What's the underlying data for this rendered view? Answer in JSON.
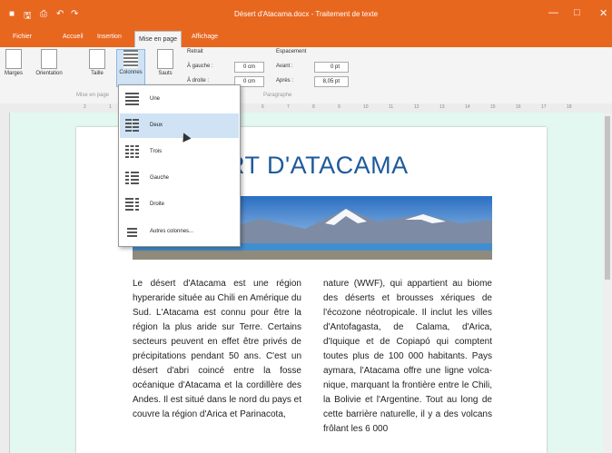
{
  "window": {
    "title": "Désert d'Atacama.docx - Traitement de texte"
  },
  "quick_access": {
    "new": "■",
    "save": "🖫",
    "print": "⎙",
    "undo": "↶",
    "redo": "↷"
  },
  "window_controls": {
    "minimize": "—",
    "maximize": "□",
    "close": "✕"
  },
  "tabs": [
    "Fichier",
    "Accueil",
    "Insertion",
    "Mise en page",
    "Affichage"
  ],
  "active_tab": "Mise en page",
  "ribbon": {
    "buttons": [
      "Marges",
      "Orientation",
      "Taille",
      "Colonnes",
      "Sauts"
    ],
    "retrait": {
      "label": "Retrait",
      "left_label": "À gauche :",
      "left_value": "0 cm",
      "right_label": "À droite :",
      "right_value": "0 cm"
    },
    "espacement": {
      "label": "Espacement",
      "before_label": "Avant :",
      "before_value": "0 pt",
      "after_label": "Après :",
      "after_value": "8,05 pt"
    },
    "group_labels": [
      "Mise en page",
      "Paragraphe"
    ]
  },
  "ruler_ticks": [
    "2",
    "1",
    "1",
    "2",
    "3",
    "4",
    "5",
    "6",
    "7",
    "8",
    "9",
    "10",
    "11",
    "12",
    "13",
    "14",
    "15",
    "16",
    "17",
    "18"
  ],
  "columns_menu": {
    "items": [
      "Une",
      "Deux",
      "Trois",
      "Gauche",
      "Droite",
      "Autres colonnes..."
    ],
    "highlighted": "Deux"
  },
  "document": {
    "heading": "RT D'ATACAMA",
    "col1": "Le désert d'Atacama est une région hyperaride située au Chili en Amérique du Sud. L'Atacama est connu pour être la région la plus aride sur Terre. Certains secteurs peuvent en effet être privés de précipitations pendant 50 ans. C'est un désert d'abri coincé entre la fosse océanique d'Atacama et la cordillère des Andes. Il est situé dans le nord du pays et couvre la région d'Arica et Parinacota,",
    "col2": "nature (WWF), qui appartient au biome des déserts et brousses xériques de l'écozone néotropicale. Il inclut les villes d'Antofagasta, de Calama, d'Arica, d'Iquique et de Copiapó qui comptent toutes plus de 100 000 habitants. Pays aymara, l'Atacama offre une ligne volca-nique, marquant la frontière entre le Chili, la Bolivie et l'Argentine. Tout au long de cette barrière naturelle, il y a des volcans frôlant les 6 000"
  },
  "colors": {
    "accent": "#e8671f",
    "heading": "#1d5a9c",
    "canvas": "#e3f8f0",
    "menu_highlight": "#cfe3f5"
  }
}
